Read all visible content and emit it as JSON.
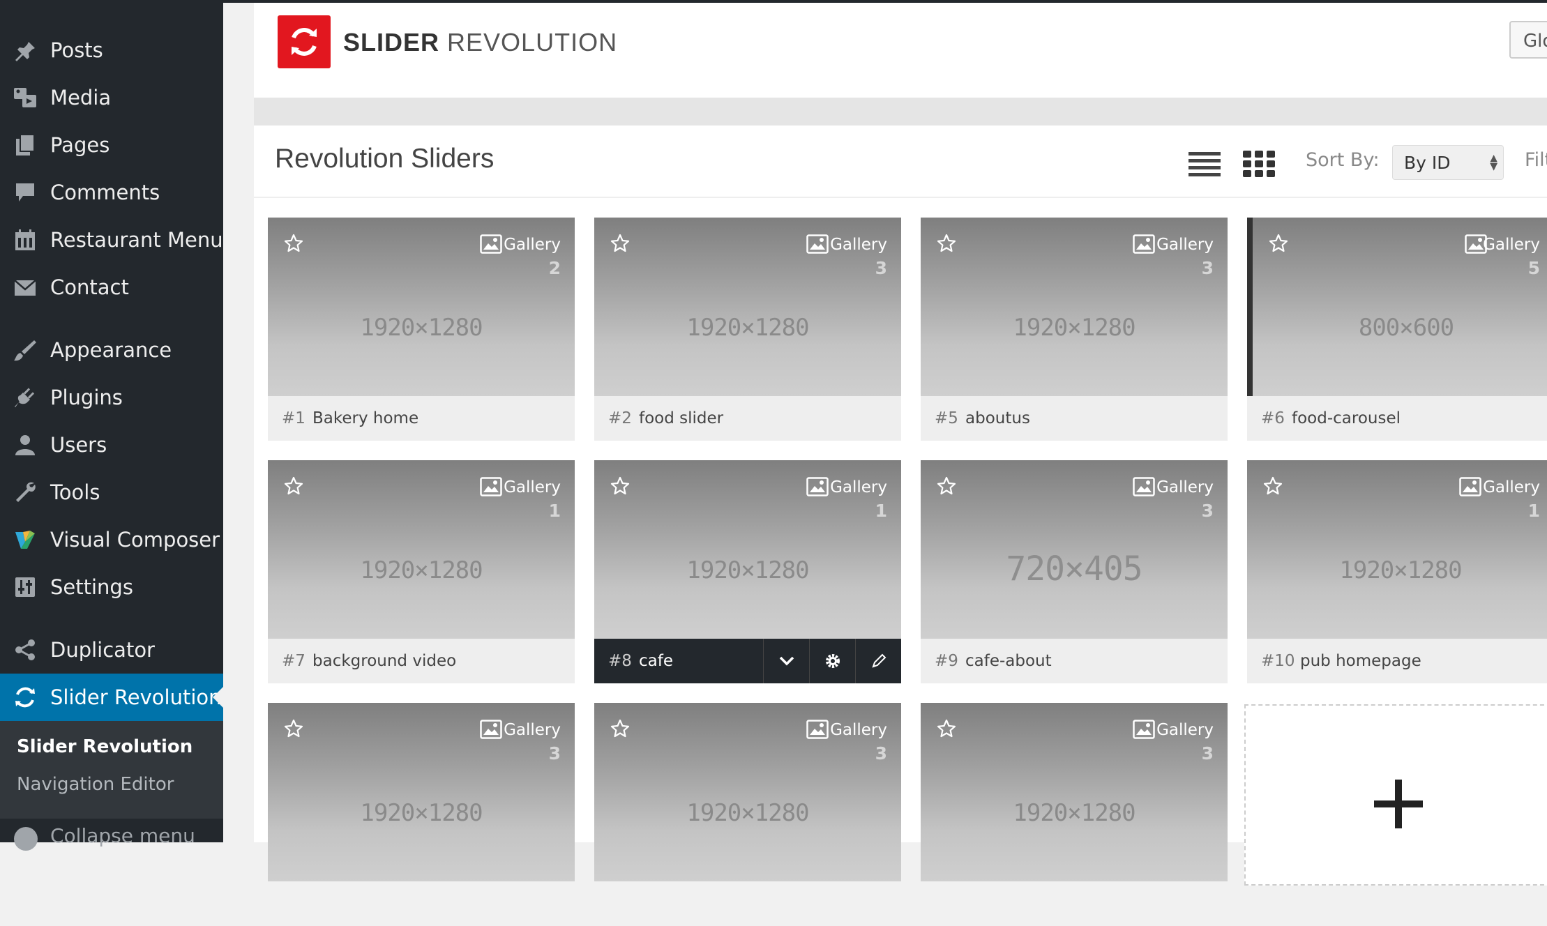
{
  "sidebar": {
    "items": [
      {
        "label": "Posts",
        "icon": "pin-icon"
      },
      {
        "label": "Media",
        "icon": "media-icon"
      },
      {
        "label": "Pages",
        "icon": "pages-icon"
      },
      {
        "label": "Comments",
        "icon": "comment-icon"
      },
      {
        "label": "Restaurant Menu",
        "icon": "calendar-icon"
      },
      {
        "label": "Contact",
        "icon": "envelope-icon"
      },
      {
        "label": "Appearance",
        "icon": "paintbrush-icon"
      },
      {
        "label": "Plugins",
        "icon": "plug-icon"
      },
      {
        "label": "Users",
        "icon": "user-icon"
      },
      {
        "label": "Tools",
        "icon": "wrench-icon"
      },
      {
        "label": "Visual Composer",
        "icon": "visual-composer-icon"
      },
      {
        "label": "Settings",
        "icon": "settings-icon"
      },
      {
        "label": "Duplicator",
        "icon": "share-icon"
      },
      {
        "label": "Slider Revolution",
        "icon": "refresh-icon",
        "active": true
      }
    ],
    "submenu": [
      {
        "label": "Slider Revolution",
        "current": true
      },
      {
        "label": "Navigation Editor",
        "current": false
      }
    ],
    "collapse_label": "Collapse menu"
  },
  "header": {
    "logo_bold": "SLIDER",
    "logo_light": "REVOLUTION",
    "global_button_label": "Glo",
    "accent_color": "#e2171f"
  },
  "panel": {
    "title": "Revolution Sliders",
    "sort_label": "Sort By:",
    "sort_value": "By ID",
    "filter_label": "Filt"
  },
  "sliders": [
    {
      "id": "#1",
      "name": "Bakery home",
      "type": "Gallery",
      "count": "2",
      "dims": "1920×1280"
    },
    {
      "id": "#2",
      "name": "food slider",
      "type": "Gallery",
      "count": "3",
      "dims": "1920×1280"
    },
    {
      "id": "#5",
      "name": "aboutus",
      "type": "Gallery",
      "count": "3",
      "dims": "1920×1280"
    },
    {
      "id": "#6",
      "name": "food-carousel",
      "type": "Gallery",
      "count": "5",
      "dims": "800×600"
    },
    {
      "id": "#7",
      "name": "background video",
      "type": "Gallery",
      "count": "1",
      "dims": "1920×1280"
    },
    {
      "id": "#8",
      "name": "cafe",
      "type": "Gallery",
      "count": "1",
      "dims": "1920×1280"
    },
    {
      "id": "#9",
      "name": "cafe-about",
      "type": "Gallery",
      "count": "3",
      "dims": "720×405"
    },
    {
      "id": "#10",
      "name": "pub homepage",
      "type": "Gallery",
      "count": "1",
      "dims": "1920×1280"
    },
    {
      "id": "",
      "name": "",
      "type": "Gallery",
      "count": "3",
      "dims": "1920×1280"
    },
    {
      "id": "",
      "name": "",
      "type": "Gallery",
      "count": "3",
      "dims": "1920×1280"
    },
    {
      "id": "",
      "name": "",
      "type": "Gallery",
      "count": "3",
      "dims": "1920×1280"
    }
  ]
}
